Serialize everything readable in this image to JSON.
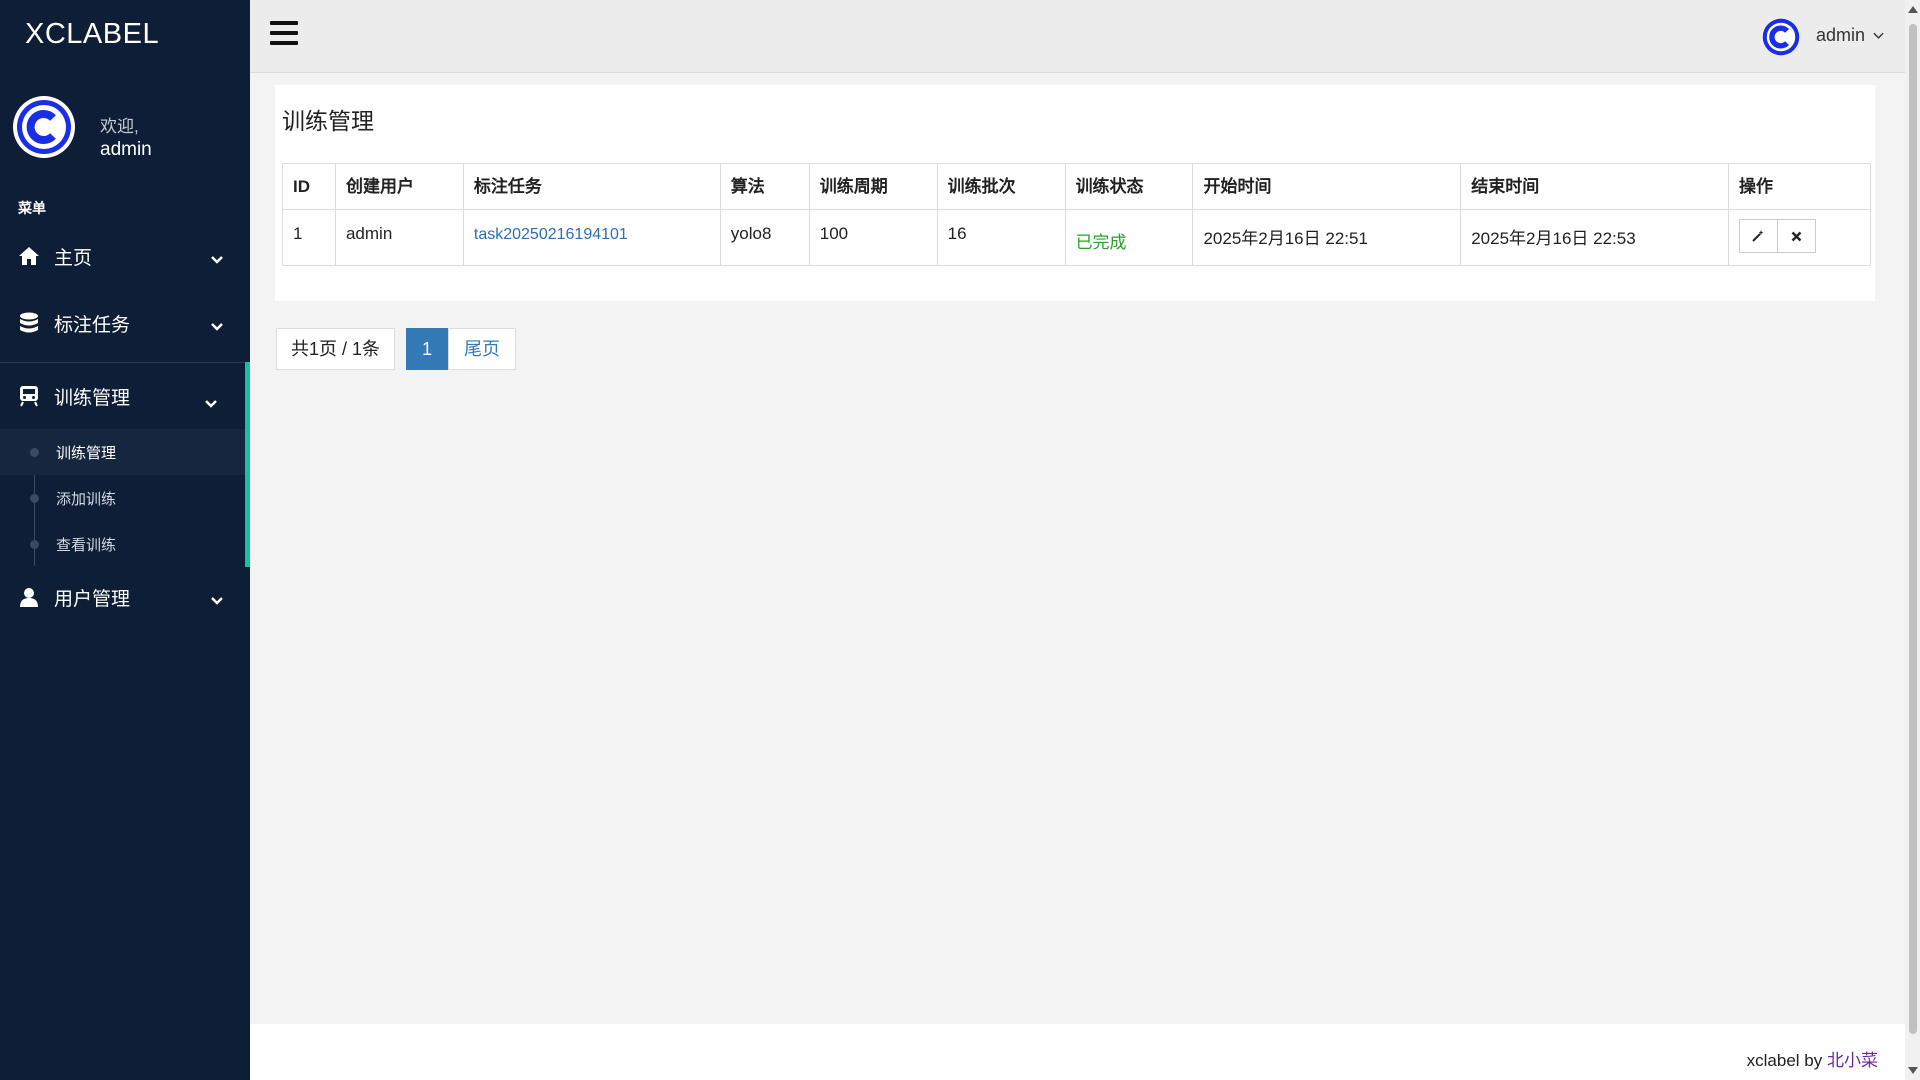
{
  "brand": "XCLABEL",
  "profile": {
    "welcome": "欢迎,",
    "name": "admin"
  },
  "menu_title": "菜单",
  "sidebar": {
    "items": [
      {
        "label": "主页",
        "icon": "home-icon"
      },
      {
        "label": "标注任务",
        "icon": "database-icon"
      },
      {
        "label": "训练管理",
        "icon": "train-icon"
      },
      {
        "label": "用户管理",
        "icon": "user-icon"
      }
    ],
    "submenu": [
      {
        "label": "训练管理"
      },
      {
        "label": "添加训练"
      },
      {
        "label": "查看训练"
      }
    ]
  },
  "header": {
    "user": "admin"
  },
  "main": {
    "title": "训练管理",
    "table": {
      "headers": [
        "ID",
        "创建用户",
        "标注任务",
        "算法",
        "训练周期",
        "训练批次",
        "训练状态",
        "开始时间",
        "结束时间",
        "操作"
      ],
      "rows": [
        {
          "id": "1",
          "user": "admin",
          "task": "task20250216194101",
          "algorithm": "yolo8",
          "epochs": "100",
          "batch": "16",
          "status": "已完成",
          "start": "2025年2月16日 22:51",
          "end": "2025年2月16日 22:53"
        }
      ]
    }
  },
  "pagination": {
    "info": "共1页 / 1条",
    "current": "1",
    "last": "尾页"
  },
  "footer": {
    "prefix": "xclabel by",
    "author": "北小菜"
  },
  "colors": {
    "sidebar_bg": "#0e1e37",
    "accent": "#18c29c",
    "primary": "#337ab7",
    "success": "#2aa12a",
    "logo_blue": "#1a2ee6"
  }
}
